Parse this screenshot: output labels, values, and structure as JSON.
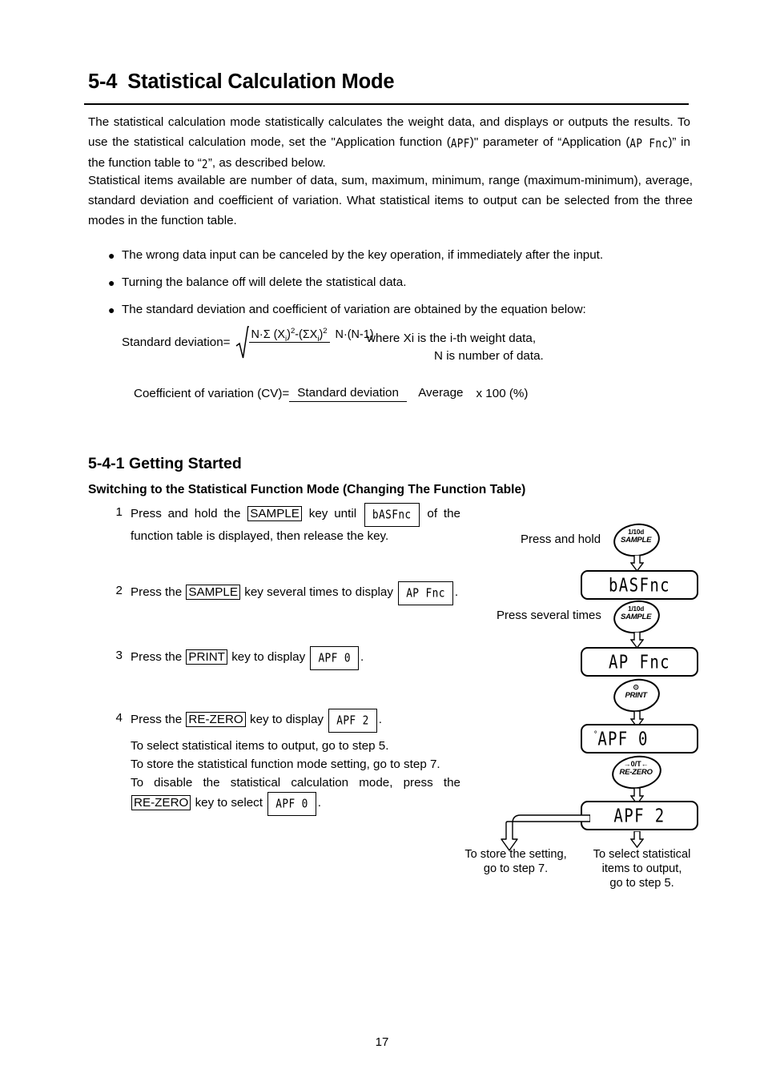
{
  "heading": {
    "number": "5-4",
    "title": "Statistical Calculation Mode"
  },
  "paragraphs": {
    "p1_a": "The statistical calculation mode statistically calculates the weight data, and displays or outputs the results. To use the statistical calculation mode, set the \"Application function (",
    "p1_apf": "APF",
    "p1_b": ")\" parameter of “Application (",
    "p1_apfnc": "AP Fnc",
    "p1_c": ")” in the function table to “",
    "p1_two": "2",
    "p1_d": "”, as described below.",
    "p2": "Statistical items available are number of data, sum, maximum, minimum, range (maximum-minimum), average, standard deviation and coefficient of variation. What statistical items to output can be selected from the three modes in the function table."
  },
  "bullets": [
    "The wrong data input can be canceled by the key operation, if immediately after the input.",
    "Turning the balance off will delete the statistical data.",
    "The standard deviation and coefficient of variation are obtained by the equation below:"
  ],
  "equations": {
    "sd_label": "Standard deviation=",
    "sd_numerator_1": "N·Σ (X",
    "sd_numerator_sub1": "i",
    "sd_numerator_2": ")",
    "sd_numerator_sup1": "2",
    "sd_numerator_3": "-(ΣX",
    "sd_numerator_sub2": "i",
    "sd_numerator_4": ")",
    "sd_numerator_sup2": "2",
    "sd_denominator": "N·(N-1)",
    "where_line1": "where Xi is the i-th weight data,",
    "where_line2": "N is number of data.",
    "cv_label": "Coefficient of variation (CV)=",
    "cv_numerator": "Standard deviation",
    "cv_denominator": "Average",
    "cv_tail": "x 100 (%)"
  },
  "section": {
    "sub_number": "5-4-1",
    "sub_title": "Getting Started",
    "sub_sub_title": "Switching to the Statistical Function Mode (Changing The Function Table)"
  },
  "steps": [
    {
      "num": "1",
      "t1": "Press and hold the",
      "key": "SAMPLE",
      "t2": "key until",
      "lcd": "bASFnc",
      "t3": "of the function table is displayed, then release the key."
    },
    {
      "num": "2",
      "t1": "Press the",
      "key": "SAMPLE",
      "t2": "key several times to display",
      "lcd": "AP Fnc",
      "t3": "."
    },
    {
      "num": "3",
      "t1": "Press the",
      "key": "PRINT",
      "t2": "key to display",
      "lcd": "APF 0",
      "t3": "."
    },
    {
      "num": "4",
      "t1": "Press the",
      "key": "RE-ZERO",
      "t2": "key to display",
      "lcd": "APF 2",
      "t3": "."
    }
  ],
  "step4_note": {
    "l1": "To select statistical items to output, go to step 5.",
    "l2": "To store the statistical function mode setting, go to step 7.",
    "l3": "To disable the statistical calculation mode, press the",
    "key": "RE-ZERO",
    "l4": "key to select",
    "lcd": "APF 0",
    "l5": "."
  },
  "flow": {
    "label_hold": "Press and hold",
    "label_several": "Press several times",
    "keys": {
      "sample_top": "1/10d",
      "sample_bot": "SAMPLE",
      "print_top": "⊙",
      "print_bot": "PRINT",
      "rezero_top": "→0/T←",
      "rezero_bot": "RE-ZERO"
    },
    "displays": {
      "d1": "bASFnc",
      "d2": "AP Fnc",
      "d3_deg": "°",
      "d3": "APF     0",
      "d4": "APF     2"
    },
    "caption_left_l1": "To store the setting,",
    "caption_left_l2": "go to step 7.",
    "caption_right_l1": "To select statistical",
    "caption_right_l2": "items to output,",
    "caption_right_l3": "go to step 5."
  },
  "page_number": "17"
}
